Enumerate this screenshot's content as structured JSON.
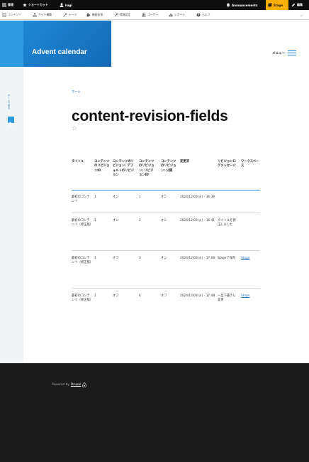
{
  "toolbar": {
    "manage": "管理",
    "shortcuts": "ショートカット",
    "user": "hagi",
    "announcements": "Announcements",
    "stage": "Stage",
    "edit": "編集"
  },
  "admin_menu": [
    {
      "label": "コンテンツ",
      "icon": "content-icon"
    },
    {
      "label": "サイト構築",
      "icon": "structure-icon"
    },
    {
      "label": "テーマ",
      "icon": "appearance-icon"
    },
    {
      "label": "機能拡張",
      "icon": "extend-icon"
    },
    {
      "label": "環境設定",
      "icon": "config-icon"
    },
    {
      "label": "ユーザー",
      "icon": "people-icon"
    },
    {
      "label": "レポート",
      "icon": "reports-icon"
    },
    {
      "label": "ヘルプ",
      "icon": "help-icon"
    }
  ],
  "collapse_glyph": "|←",
  "site_name": "Advent calendar",
  "menu_label": "メニュー",
  "vertical_link": "ホームへ戻る",
  "breadcrumb": "ホーム",
  "page_title": "content-revision-fields",
  "table": {
    "headers": [
      "タイトル",
      "コンテンツのリビジョンID",
      "コンテンツのリビジョン: デフォルトのリビジョン",
      "コンテンツのリビジョン: リビジョンID",
      "コンテンツのリビジョン: 公開",
      "変更済",
      "リビジョンログメッセージ",
      "ワークスペース"
    ],
    "rows": [
      [
        "最初のコンテンツ",
        "1",
        "オン",
        "1",
        "オン",
        "2024/12/03(火) - 16:39",
        "",
        ""
      ],
      [
        "最初のコンテンツ（修正版）",
        "1",
        "オン",
        "2",
        "オン",
        "2024/12/03(火) - 16:41",
        "タイトルを修正しました",
        ""
      ],
      [
        "最初のコンテンツ（修正版）",
        "1",
        "オフ",
        "3",
        "オン",
        "2024/12/03(火) - 17:08",
        "Stageで保存",
        "Stage"
      ],
      [
        "最初のコンテンツ（修正版）",
        "1",
        "オフ",
        "4",
        "オフ",
        "2024/12/03(火) - 17:48",
        "一旦下書きに変更",
        "Stage"
      ]
    ]
  },
  "footer": {
    "powered_by": "Powered by",
    "drupal": "Drupal"
  },
  "colors": {
    "brand_blue": "#1e88d6",
    "stage_yellow": "#ffb000",
    "toolbar_dark": "#0f0f0f",
    "footer_dark": "#1b1b1b"
  }
}
